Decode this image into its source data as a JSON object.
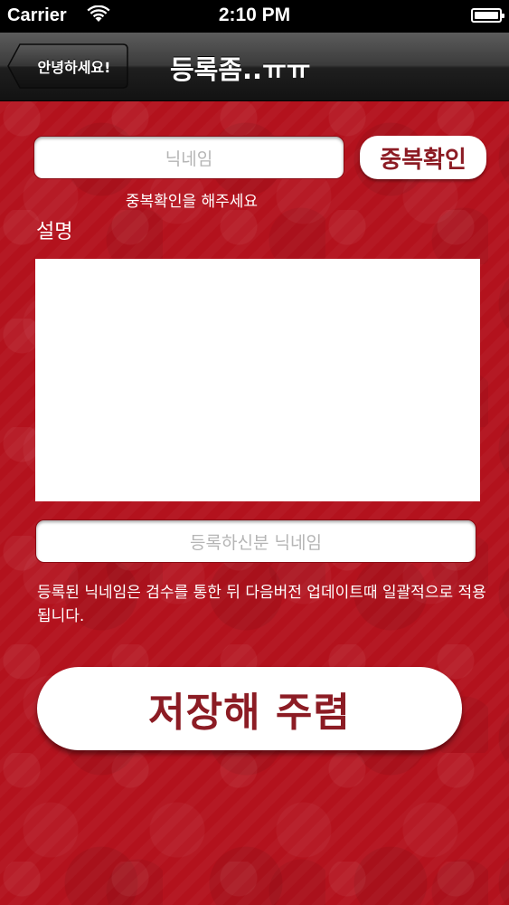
{
  "status_bar": {
    "carrier": "Carrier",
    "time": "2:10 PM"
  },
  "nav": {
    "back_label": "안녕하세요!",
    "title": "등록좀..ㅠㅠ"
  },
  "form": {
    "nickname_placeholder": "닉네임",
    "check_button_label": "중복확인",
    "check_hint": "중복확인을 해주세요",
    "description_label": "설명",
    "register_placeholder": "등록하신분 닉네임",
    "notice": "등록된 닉네임은 검수를 통한 뒤 다음버전 업데이트때 일괄적으로 적용 됩니다.",
    "save_label": "저장해 주렴"
  },
  "colors": {
    "background_red": "#b3121d",
    "button_text": "#8c1c24"
  }
}
